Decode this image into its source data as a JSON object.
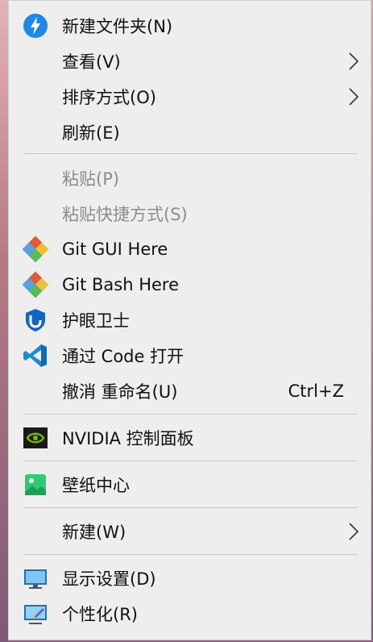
{
  "menu": {
    "items": [
      {
        "label": "新建文件夹(N)",
        "icon": "folder-lightning-icon"
      },
      {
        "label": "查看(V)",
        "submenu": true
      },
      {
        "label": "排序方式(O)",
        "submenu": true
      },
      {
        "label": "刷新(E)"
      },
      {
        "label": "粘贴(P)",
        "disabled": true
      },
      {
        "label": "粘贴快捷方式(S)",
        "disabled": true
      },
      {
        "label": "Git GUI Here",
        "icon": "git-gui-icon"
      },
      {
        "label": "Git Bash Here",
        "icon": "git-bash-icon"
      },
      {
        "label": "护眼卫士",
        "icon": "shield-eye-icon"
      },
      {
        "label": "通过 Code 打开",
        "icon": "vscode-icon"
      },
      {
        "label": "撤消 重命名(U)",
        "shortcut": "Ctrl+Z"
      },
      {
        "label": "NVIDIA 控制面板",
        "icon": "nvidia-icon"
      },
      {
        "label": "壁纸中心",
        "icon": "wallpaper-icon"
      },
      {
        "label": "新建(W)",
        "submenu": true
      },
      {
        "label": "显示设置(D)",
        "icon": "display-settings-icon"
      },
      {
        "label": "个性化(R)",
        "icon": "personalize-icon"
      }
    ]
  },
  "colors": {
    "menu_bg": "#eeeeee",
    "text": "#101010",
    "disabled_text": "#8c8c8c",
    "separator": "#c8c8c8",
    "accent_blue": "#1e88e5",
    "nvidia_green": "#76b900"
  }
}
